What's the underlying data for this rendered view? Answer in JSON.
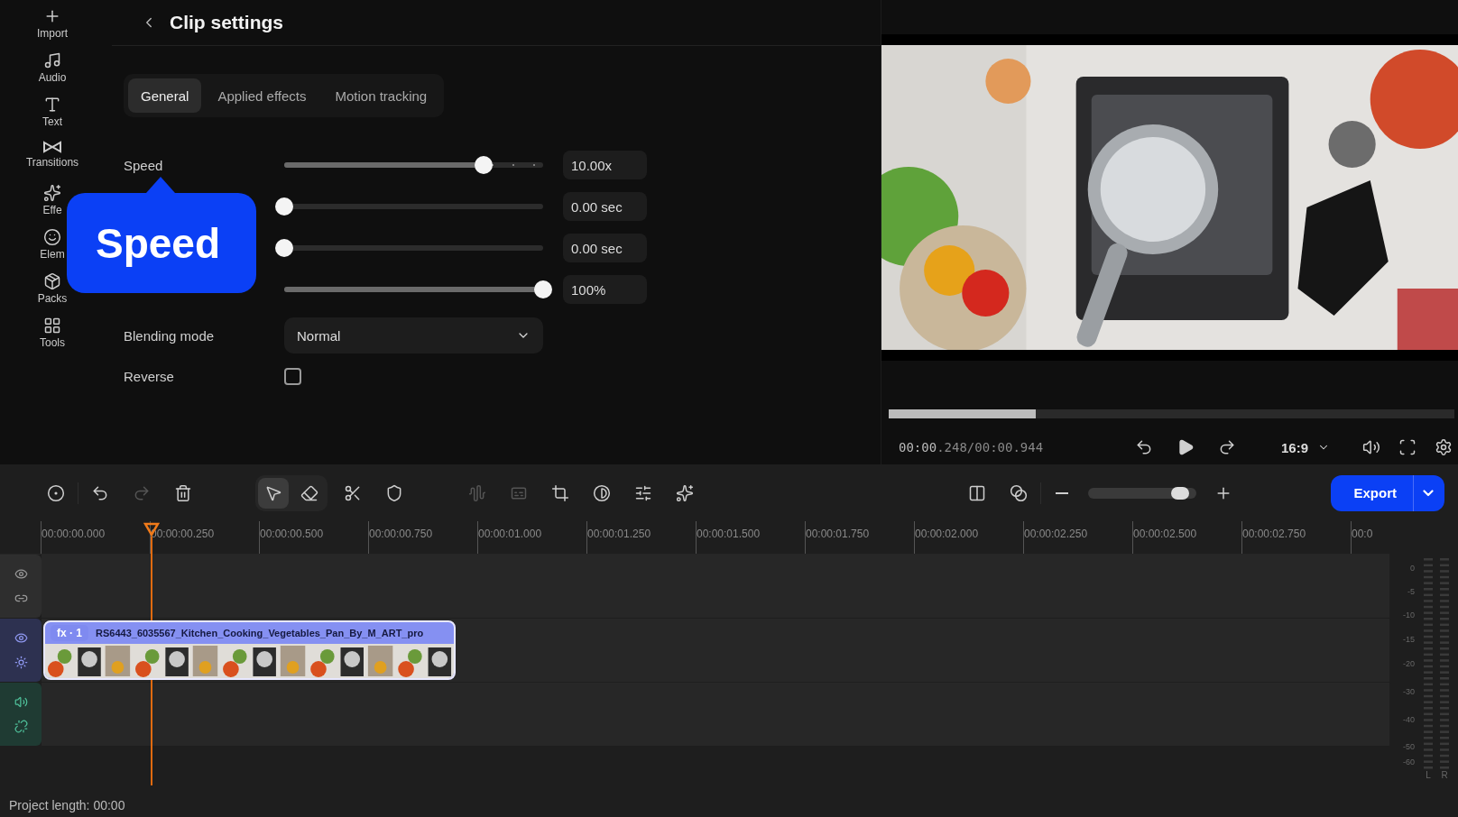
{
  "sidebar": {
    "items": [
      {
        "label": "Import"
      },
      {
        "label": "Audio"
      },
      {
        "label": "Text"
      },
      {
        "label": "Transitions"
      },
      {
        "label": "Effe"
      },
      {
        "label": "Elem"
      },
      {
        "label": "Packs"
      },
      {
        "label": "Tools"
      }
    ]
  },
  "clip_settings": {
    "title": "Clip settings",
    "tabs": [
      {
        "label": "General",
        "selected": true
      },
      {
        "label": "Applied effects",
        "selected": false
      },
      {
        "label": "Motion tracking",
        "selected": false
      }
    ],
    "rows": [
      {
        "kind": "stepped",
        "label": "Speed",
        "level": 0.77,
        "value": "10.00x"
      },
      {
        "kind": "plain",
        "level": 0,
        "value": "0.00 sec"
      },
      {
        "kind": "plain",
        "level": 0,
        "value": "0.00 sec"
      },
      {
        "kind": "plain",
        "level": 1,
        "value": "100%"
      }
    ],
    "blending": {
      "label": "Blending mode",
      "value": "Normal"
    },
    "reverse": {
      "label": "Reverse",
      "checked": false
    }
  },
  "tooltip": {
    "text": "Speed"
  },
  "preview": {
    "progress": {
      "level": 0.26
    },
    "time": "**00:00**.248/00:00.944",
    "aspect": "16:9"
  },
  "toolbar": {
    "items": [
      {
        "disabled": false
      },
      {
        "disabled": false
      },
      {
        "disabled": true
      },
      {
        "disabled": false
      }
    ],
    "tools": [
      {
        "selected": true
      },
      {
        "selected": false
      }
    ],
    "edit": [
      {
        "disabled": false
      },
      {
        "disabled": false
      },
      {
        "disabled": true
      },
      {
        "disabled": true
      },
      {
        "disabled": false
      },
      {
        "disabled": false
      },
      {
        "disabled": false
      },
      {
        "disabled": false
      }
    ],
    "zoom": {
      "level": 0.85
    },
    "export": "Export"
  },
  "ruler": [
    "00:00:00.000",
    "00:00:00.250",
    "00:00:00.500",
    "00:00:00.750",
    "00:00:01.000",
    "00:00:01.250",
    "00:00:01.500",
    "00:00:01.750",
    "00:00:02.000",
    "00:00:02.250",
    "00:00:02.500",
    "00:00:02.750",
    "00:0"
  ],
  "tracks": [
    {
      "kind": "empty"
    },
    {
      "kind": "video",
      "clip": {
        "badge": "fx · 1",
        "name": "RS6443_6035567_Kitchen_Cooking_Vegetables_Pan_By_M_ART_pro"
      }
    },
    {
      "kind": "audio"
    }
  ],
  "meter": {
    "scale": [
      "0",
      "-5",
      "-10",
      "-15",
      "-20",
      "-30",
      "-40",
      "-50",
      "-60"
    ],
    "channels": [
      "L",
      "R"
    ]
  },
  "status": "Project length: 00:00"
}
